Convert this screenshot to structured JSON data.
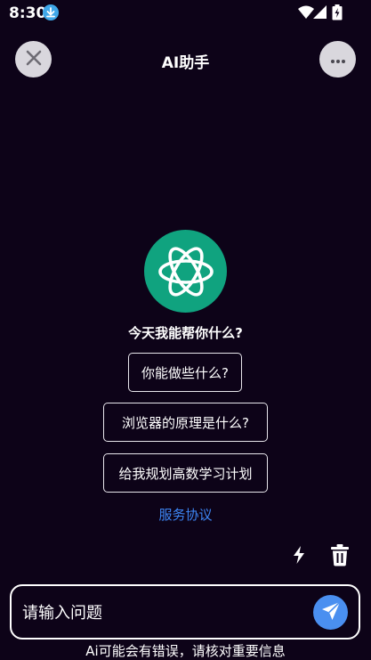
{
  "status_bar": {
    "time": "8:30",
    "icons": [
      "download-icon",
      "wifi-icon",
      "signal-icon",
      "battery-icon"
    ]
  },
  "header": {
    "title": "AI助手",
    "close_icon": "close-icon",
    "more_icon": "more-icon"
  },
  "main": {
    "logo_icon": "openai-logo-icon",
    "greeting": "今天我能帮你什么?",
    "suggestions": [
      {
        "label": "你能做些什么?"
      },
      {
        "label": "浏览器的原理是什么?"
      },
      {
        "label": "给我规划高数学习计划"
      }
    ],
    "service_link": "服务协议"
  },
  "tools": {
    "flash_icon": "flash-icon",
    "trash_icon": "trash-icon"
  },
  "input": {
    "placeholder": "请输入问题",
    "value": "",
    "send_icon": "send-icon"
  },
  "disclaimer": "Ai可能会有错误，请核对重要信息",
  "colors": {
    "background": "#0d0318",
    "logo_green": "#10a37f",
    "link_blue": "#3d86f5",
    "send_blue": "#4a8ff0",
    "button_gray": "#d9d7dd"
  }
}
